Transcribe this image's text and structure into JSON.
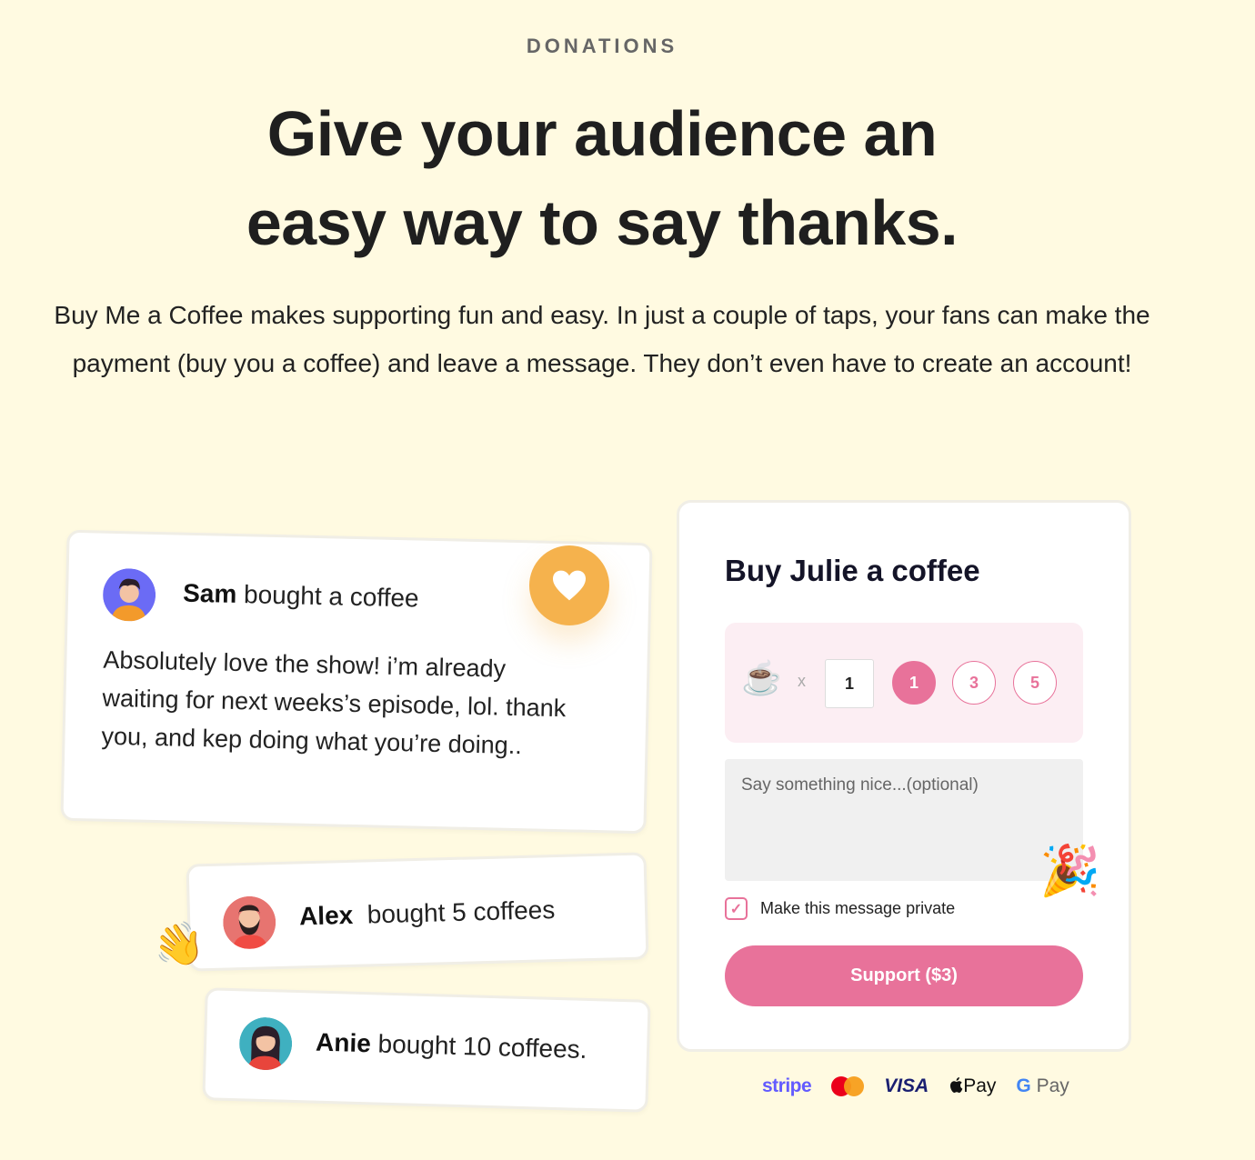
{
  "section": {
    "eyebrow": "DONATIONS",
    "headline_line1": "Give your audience an",
    "headline_line2": "easy way to say thanks.",
    "description": "Buy Me a Coffee makes supporting fun and easy. In just a couple of taps, your fans can make the payment (buy you a coffee) and leave a message. They don’t even have to create an account!"
  },
  "supporters": [
    {
      "name": "Sam",
      "action": " bought a coffee",
      "message": "Absolutely love the show! i’m already waiting for next weeks’s episode, lol. thank you, and kep doing what you’re doing..",
      "avatar_color": "#6b6bf5"
    },
    {
      "name": "Alex",
      "action": "  bought 5 coffees",
      "avatar_color": "#e77470"
    },
    {
      "name": "Anie",
      "action": " bought 10 coffees.",
      "avatar_color": "#3fb0c0"
    }
  ],
  "decor": {
    "heart_icon": "heart-icon",
    "wave_emoji": "👋",
    "party_emoji": "🎉",
    "heart_color": "#f5b24d"
  },
  "widget": {
    "title": "Buy Julie a coffee",
    "coffee_emoji": "☕",
    "times": "x",
    "quantity_value": "1",
    "quantity_options": [
      "1",
      "3",
      "5"
    ],
    "selected_option": "1",
    "message_placeholder": "Say something nice...(optional)",
    "private_checkbox_label": "Make this message private",
    "private_checked": true,
    "support_button": "Support ($3)",
    "accent_color": "#e8729a"
  },
  "payment_methods": {
    "stripe": "stripe",
    "mastercard": "mastercard",
    "visa": "VISA",
    "apple_pay": "Pay",
    "apple_pay_text": "Pay",
    "google_pay_g": "G",
    "google_pay_text": " Pay"
  }
}
